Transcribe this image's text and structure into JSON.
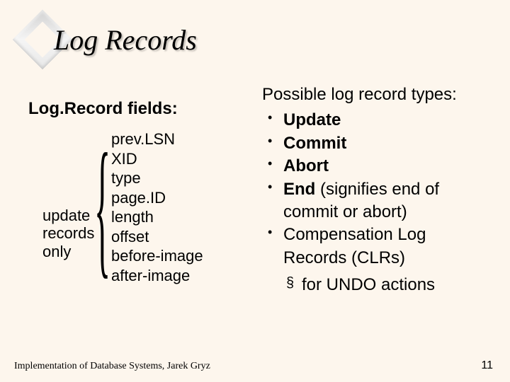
{
  "title": "Log Records",
  "left": {
    "subhead": "Log.Record fields:",
    "annotation_l1": "update",
    "annotation_l2": "records",
    "annotation_l3": "only",
    "fields": {
      "f0": "prev.LSN",
      "f1": "XID",
      "f2": "type",
      "f3": "page.ID",
      "f4": "length",
      "f5": "offset",
      "f6": "before-image",
      "f7": "after-image"
    }
  },
  "right": {
    "heading": "Possible log record types:",
    "items": {
      "i0_bold": "Update",
      "i1_bold": "Commit",
      "i2_bold": "Abort",
      "i3_bold": "End",
      "i3_tail": " (signifies end of commit or abort)",
      "i4_text": "Compensation Log Records (CLRs)"
    },
    "sub": "for UNDO actions"
  },
  "footer": {
    "left": "Implementation of Database Systems, Jarek Gryz",
    "page": "11"
  }
}
